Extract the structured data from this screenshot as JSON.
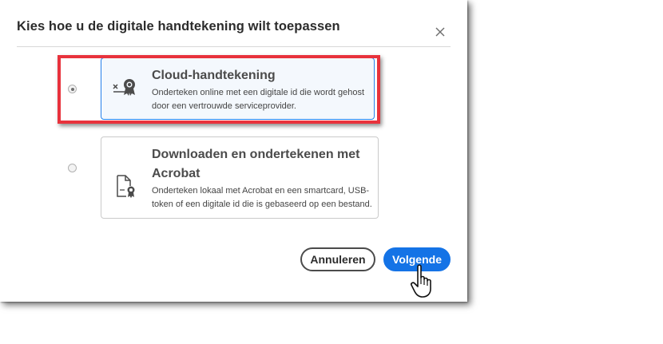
{
  "dialog": {
    "title": "Kies hoe u de digitale handtekening wilt toepassen",
    "close_icon": "close-icon"
  },
  "options": [
    {
      "title": "Cloud-handtekening",
      "description_lines": [
        "Onderteken online met een digitale id die wordt gehost",
        "door een vertrouwde serviceprovider."
      ],
      "icon": "cloud-signature-icon",
      "selected": true
    },
    {
      "title_lines": [
        "Downloaden en ondertekenen met",
        "Acrobat"
      ],
      "description_lines": [
        "Onderteken lokaal met Acrobat en een smartcard, USB-",
        "token of een digitale id die is gebaseerd op een bestand."
      ],
      "icon": "certificate-document-icon",
      "selected": false
    }
  ],
  "buttons": {
    "cancel_label": "Annuleren",
    "next_label": "Volgende"
  },
  "colors": {
    "accent": "#1473e6",
    "highlight": "#e8323c",
    "selected_card_bg": "#f4f8fd"
  }
}
